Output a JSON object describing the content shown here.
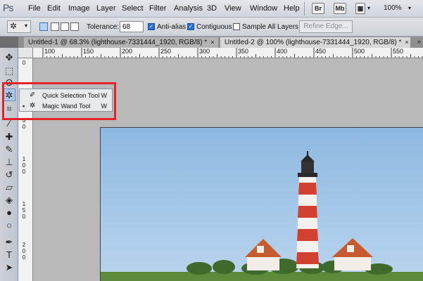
{
  "app": {
    "logo": "Ps"
  },
  "menu": [
    "File",
    "Edit",
    "Image",
    "Layer",
    "Select",
    "Filter",
    "Analysis",
    "3D",
    "View",
    "Window",
    "Help"
  ],
  "app_bar": {
    "bridge_label": "Br",
    "minibridge_label": "Mb",
    "zoom": "100%"
  },
  "options": {
    "tolerance_label": "Tolerance:",
    "tolerance_value": "68",
    "anti_alias_label": "Anti-alias",
    "anti_alias_checked": true,
    "contiguous_label": "Contiguous",
    "contiguous_checked": true,
    "sample_all_label": "Sample All Layers",
    "sample_all_checked": false,
    "refine_edge_label": "Refine Edge..."
  },
  "tabs": [
    {
      "label": "Untitled-1 @ 68.3% (lighthouse-7331444_1920, RGB/8) *",
      "close": "×",
      "active": false
    },
    {
      "label": "Untitled-2 @ 100% (lighthouse-7331444_1920, RGB/8) *",
      "close": "×",
      "active": true
    }
  ],
  "ruler_top": [
    "100",
    "150",
    "200",
    "250",
    "300",
    "350",
    "400",
    "450",
    "500",
    "550"
  ],
  "ruler_left": [
    "0",
    "5",
    "0",
    "1",
    "0",
    "0",
    "1",
    "5",
    "0",
    "2",
    "0",
    "0"
  ],
  "flyout": {
    "items": [
      {
        "label": "Quick Selection Tool",
        "shortcut": "W",
        "selected": false,
        "icon": "quick-selection-icon"
      },
      {
        "label": "Magic Wand Tool",
        "shortcut": "W",
        "selected": true,
        "icon": "magic-wand-icon"
      }
    ]
  },
  "colors": {
    "highlight": "#e2232a",
    "sky": "#a6c8e8",
    "lighthouse_red": "#d2412f"
  }
}
